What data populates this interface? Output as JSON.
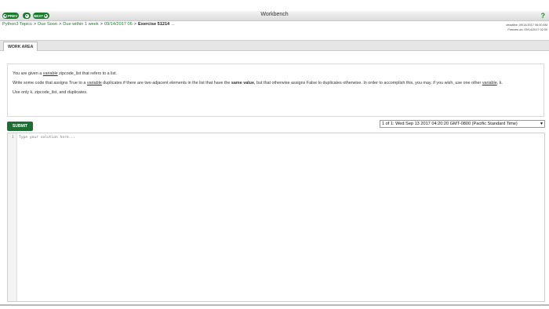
{
  "window": {
    "title": "Workbench"
  },
  "nav": {
    "prev_label": "PREV",
    "next_label": "NEXT",
    "help_label": "?"
  },
  "breadcrumb": {
    "items": [
      "Python3 Topics",
      "Due Soon",
      "Due within 1 week",
      "09/14/2017 06"
    ],
    "separator": ">",
    "current": "Exercise 51214",
    "more": "..."
  },
  "meta": {
    "deadline": "deadline: 09/14/2017 06:00 AM",
    "freezes": "Freezes on: 09/14/2017 02:00"
  },
  "tabs": [
    {
      "label": "WORK AREA"
    }
  ],
  "instructions": {
    "p1_a": "You are given a ",
    "p1_link": "variable",
    "p1_b": " zipcode_list that refers to a list.",
    "p2_a": "Write some code that assigns True to a ",
    "p2_link": "variable",
    "p2_b": " duplicates if there are two adjacent elements in the list that have the ",
    "p2_bold": "same value",
    "p2_c": ", but that otherwise assigns False to duplicates otherwise. In order to accomplish this, you may, if you wish, use one other ",
    "p2_link2": "variable",
    "p2_d": ", k.",
    "p3": "Use only k, zipcode_list, and duplicates."
  },
  "submit": {
    "label": "SUBMIT"
  },
  "submission_select": {
    "selected": "1 of 1: Wed Sep 13 2017 04:20:20 GMT-0800 (Pacific Standard Time)"
  },
  "editor": {
    "line_number": "1",
    "placeholder": "Type your solution here..."
  }
}
